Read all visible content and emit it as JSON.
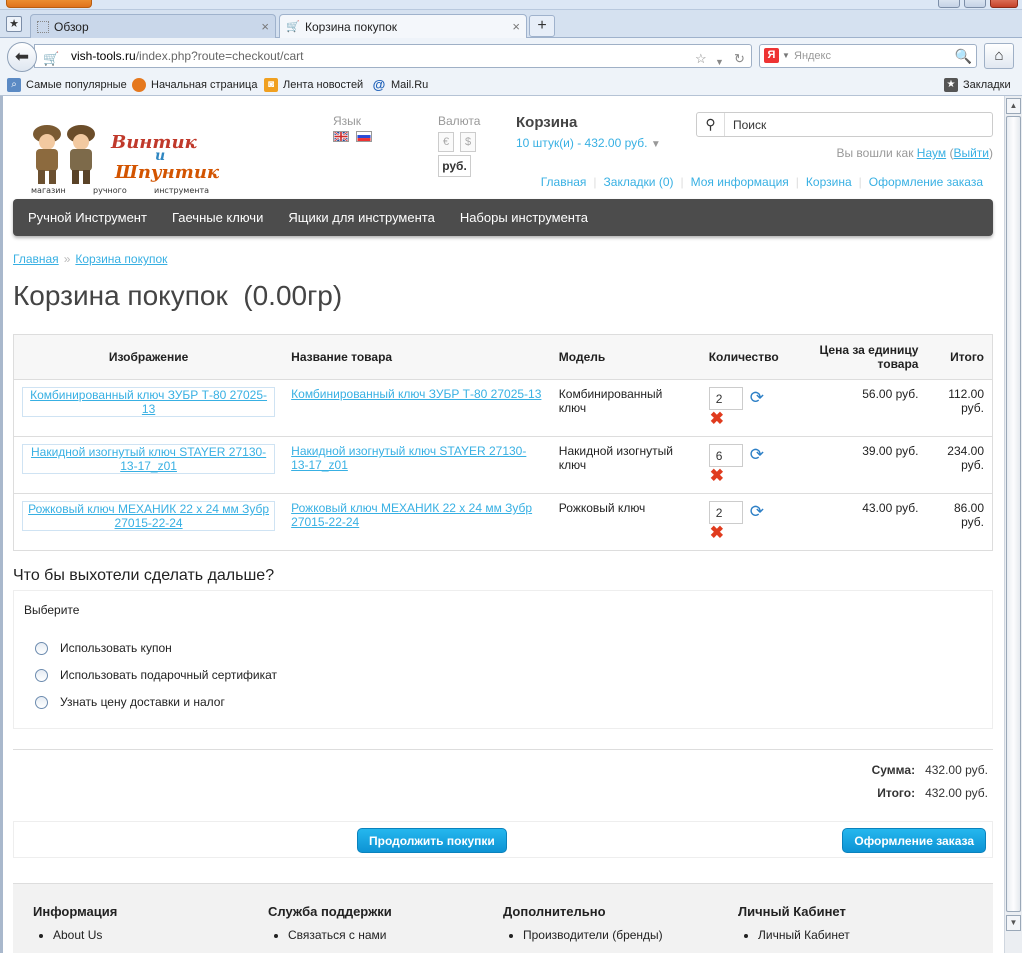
{
  "browser": {
    "tabs": [
      {
        "title": "Обзор",
        "active": false
      },
      {
        "title": "Корзина покупок",
        "active": true
      }
    ],
    "new_tab": "+",
    "url_host": "vish-tools.ru",
    "url_path": "/index.php?route=checkout/cart",
    "search_placeholder": "Яндекс",
    "bookmarks": [
      {
        "label": "Самые популярные",
        "icon": "most-visited-icon"
      },
      {
        "label": "Начальная страница",
        "icon": "firefox-icon"
      },
      {
        "label": "Лента новостей",
        "icon": "rss-icon"
      },
      {
        "label": "Mail.Ru",
        "icon": "mail-at-icon"
      }
    ],
    "bookmarks_menu": "Закладки"
  },
  "store": {
    "logo": {
      "line1": "Винтик",
      "line2": "и",
      "line3": "Шпунтик",
      "sub1": "магазин",
      "sub2": "ручного",
      "sub3": "инструмента"
    },
    "language_label": "Язык",
    "currency_label": "Валюта",
    "currency_euro": "€",
    "currency_dollar": "$",
    "currency_rub": "руб.",
    "cart_title": "Корзина",
    "cart_summary": "10 штук(и) - 432.00 руб.",
    "search_placeholder": "Поиск",
    "welcome_text": "Вы вошли как",
    "welcome_user": "Наум",
    "welcome_open": "(",
    "logout": "Выйти",
    "welcome_close": ")",
    "top_links": [
      "Главная",
      "Закладки (0)",
      "Моя информация",
      "Корзина",
      "Оформление заказа"
    ],
    "menu": [
      "Ручной Инструмент",
      "Гаечные ключи",
      "Ящики для инструмента",
      "Наборы инструмента"
    ]
  },
  "breadcrumb": [
    "Главная",
    "Корзина покупок"
  ],
  "heading": "Корзина покупок  (0.00гр)",
  "table": {
    "headers": [
      "Изображение",
      "Название товара",
      "Модель",
      "Количество",
      "Цена за единицу товара",
      "Итого"
    ],
    "rows": [
      {
        "image_alt": "Комбинированный ключ ЗУБР Т-80 27025-13",
        "name": "Комбинированный ключ ЗУБР Т-80 27025-13",
        "model": "Комбинированный ключ",
        "qty": "2",
        "price": "56.00 руб.",
        "total": "112.00 руб."
      },
      {
        "image_alt": "Накидной изогнутый ключ STAYER 27130-13-17_z01",
        "name": "Накидной изогнутый ключ STAYER 27130-13-17_z01",
        "model": "Накидной изогнутый ключ",
        "qty": "6",
        "price": "39.00 руб.",
        "total": "234.00 руб."
      },
      {
        "image_alt": "Рожковый ключ МЕХАНИК 22 х 24 мм Зубр 27015-22-24",
        "name": "Рожковый ключ МЕХАНИК 22 х 24 мм Зубр 27015-22-24",
        "model": "Рожковый ключ",
        "qty": "2",
        "price": "43.00 руб.",
        "total": "86.00 руб."
      }
    ]
  },
  "next_heading": "Что бы выхотели сделать дальше?",
  "choose_label": "Выберите",
  "options": [
    "Использовать купон",
    "Использовать подарочный сертификат",
    "Узнать цену доставки и налог"
  ],
  "totals": [
    {
      "label": "Сумма:",
      "value": "432.00 руб."
    },
    {
      "label": "Итого:",
      "value": "432.00 руб."
    }
  ],
  "buttons": {
    "continue": "Продолжить покупки",
    "checkout": "Оформление заказа"
  },
  "footer": [
    {
      "title": "Информация",
      "item": "About Us"
    },
    {
      "title": "Служба поддержки",
      "item": "Связаться с нами"
    },
    {
      "title": "Дополнительно",
      "item": "Производители (бренды)"
    },
    {
      "title": "Личный Кабинет",
      "item": "Личный Кабинет"
    }
  ],
  "colors": {
    "accent": "#38b0e3",
    "menu_bg": "#4c4c4c",
    "button": "#1aa6e3",
    "remove": "#e03b1e"
  }
}
